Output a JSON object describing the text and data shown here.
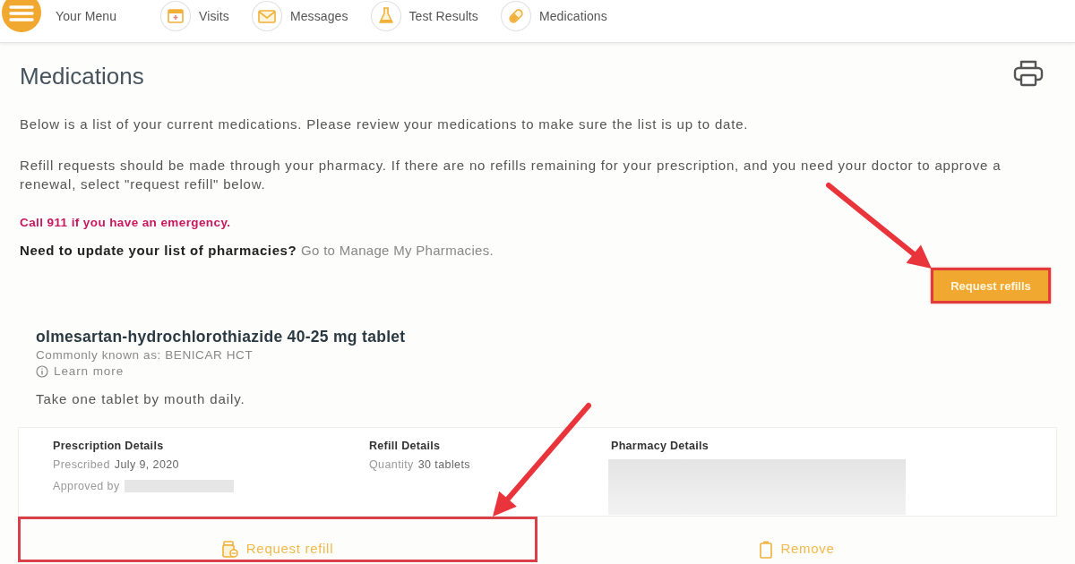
{
  "nav": {
    "menu_label": "Your Menu",
    "items": [
      {
        "label": "Visits"
      },
      {
        "label": "Messages"
      },
      {
        "label": "Test Results"
      },
      {
        "label": "Medications"
      }
    ]
  },
  "header": {
    "title": "Medications"
  },
  "notices": {
    "intro": "Below is a list of your current medications. Please review your medications to make sure the list is up to date.",
    "refill_info": "Refill requests should be made through your pharmacy. If there are no refills remaining for your prescription, and you need your doctor to approve a renewal, select \"request refill\" below.",
    "emergency": "Call 911 if you have an emergency.",
    "pharmacies_prompt": "Need to update your list of pharmacies?",
    "pharmacies_link": "Go to Manage My Pharmacies."
  },
  "request_refills": {
    "label": "Request refills",
    "highlighted": true
  },
  "medications": [
    {
      "name": "olmesartan-hydrochlorothiazide 40-25 mg tablet",
      "known_as": "Commonly known as: BENICAR HCT",
      "learn_more": "Learn more",
      "instructions": "Take one tablet by mouth daily.",
      "details": [
        {
          "heading": "Prescription Details",
          "lines": [
            {
              "label": "Prescribed",
              "value": "July 9, 2020"
            },
            {
              "label": "Approved by",
              "redacted": true
            }
          ]
        },
        {
          "heading": "Refill Details",
          "lines": [
            {
              "label": "Quantity",
              "value": "30 tablets"
            }
          ]
        },
        {
          "heading": "Pharmacy Details",
          "redacted": true
        }
      ],
      "actions": [
        {
          "kind": "refill",
          "label": "Request refill",
          "highlighted": true
        },
        {
          "kind": "remove",
          "label": "Remove",
          "highlighted": false
        }
      ]
    }
  ]
}
